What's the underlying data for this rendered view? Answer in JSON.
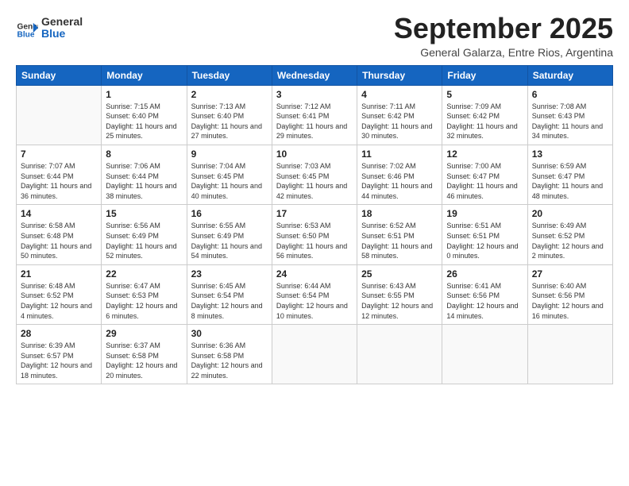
{
  "header": {
    "logo_general": "General",
    "logo_blue": "Blue",
    "month_title": "September 2025",
    "location": "General Galarza, Entre Rios, Argentina"
  },
  "weekdays": [
    "Sunday",
    "Monday",
    "Tuesday",
    "Wednesday",
    "Thursday",
    "Friday",
    "Saturday"
  ],
  "days": [
    {
      "date": "",
      "number": "",
      "sunrise": "",
      "sunset": "",
      "daylight": ""
    },
    {
      "date": "1",
      "number": "1",
      "sunrise": "Sunrise: 7:15 AM",
      "sunset": "Sunset: 6:40 PM",
      "daylight": "Daylight: 11 hours and 25 minutes."
    },
    {
      "date": "2",
      "number": "2",
      "sunrise": "Sunrise: 7:13 AM",
      "sunset": "Sunset: 6:40 PM",
      "daylight": "Daylight: 11 hours and 27 minutes."
    },
    {
      "date": "3",
      "number": "3",
      "sunrise": "Sunrise: 7:12 AM",
      "sunset": "Sunset: 6:41 PM",
      "daylight": "Daylight: 11 hours and 29 minutes."
    },
    {
      "date": "4",
      "number": "4",
      "sunrise": "Sunrise: 7:11 AM",
      "sunset": "Sunset: 6:42 PM",
      "daylight": "Daylight: 11 hours and 30 minutes."
    },
    {
      "date": "5",
      "number": "5",
      "sunrise": "Sunrise: 7:09 AM",
      "sunset": "Sunset: 6:42 PM",
      "daylight": "Daylight: 11 hours and 32 minutes."
    },
    {
      "date": "6",
      "number": "6",
      "sunrise": "Sunrise: 7:08 AM",
      "sunset": "Sunset: 6:43 PM",
      "daylight": "Daylight: 11 hours and 34 minutes."
    },
    {
      "date": "7",
      "number": "7",
      "sunrise": "Sunrise: 7:07 AM",
      "sunset": "Sunset: 6:44 PM",
      "daylight": "Daylight: 11 hours and 36 minutes."
    },
    {
      "date": "8",
      "number": "8",
      "sunrise": "Sunrise: 7:06 AM",
      "sunset": "Sunset: 6:44 PM",
      "daylight": "Daylight: 11 hours and 38 minutes."
    },
    {
      "date": "9",
      "number": "9",
      "sunrise": "Sunrise: 7:04 AM",
      "sunset": "Sunset: 6:45 PM",
      "daylight": "Daylight: 11 hours and 40 minutes."
    },
    {
      "date": "10",
      "number": "10",
      "sunrise": "Sunrise: 7:03 AM",
      "sunset": "Sunset: 6:45 PM",
      "daylight": "Daylight: 11 hours and 42 minutes."
    },
    {
      "date": "11",
      "number": "11",
      "sunrise": "Sunrise: 7:02 AM",
      "sunset": "Sunset: 6:46 PM",
      "daylight": "Daylight: 11 hours and 44 minutes."
    },
    {
      "date": "12",
      "number": "12",
      "sunrise": "Sunrise: 7:00 AM",
      "sunset": "Sunset: 6:47 PM",
      "daylight": "Daylight: 11 hours and 46 minutes."
    },
    {
      "date": "13",
      "number": "13",
      "sunrise": "Sunrise: 6:59 AM",
      "sunset": "Sunset: 6:47 PM",
      "daylight": "Daylight: 11 hours and 48 minutes."
    },
    {
      "date": "14",
      "number": "14",
      "sunrise": "Sunrise: 6:58 AM",
      "sunset": "Sunset: 6:48 PM",
      "daylight": "Daylight: 11 hours and 50 minutes."
    },
    {
      "date": "15",
      "number": "15",
      "sunrise": "Sunrise: 6:56 AM",
      "sunset": "Sunset: 6:49 PM",
      "daylight": "Daylight: 11 hours and 52 minutes."
    },
    {
      "date": "16",
      "number": "16",
      "sunrise": "Sunrise: 6:55 AM",
      "sunset": "Sunset: 6:49 PM",
      "daylight": "Daylight: 11 hours and 54 minutes."
    },
    {
      "date": "17",
      "number": "17",
      "sunrise": "Sunrise: 6:53 AM",
      "sunset": "Sunset: 6:50 PM",
      "daylight": "Daylight: 11 hours and 56 minutes."
    },
    {
      "date": "18",
      "number": "18",
      "sunrise": "Sunrise: 6:52 AM",
      "sunset": "Sunset: 6:51 PM",
      "daylight": "Daylight: 11 hours and 58 minutes."
    },
    {
      "date": "19",
      "number": "19",
      "sunrise": "Sunrise: 6:51 AM",
      "sunset": "Sunset: 6:51 PM",
      "daylight": "Daylight: 12 hours and 0 minutes."
    },
    {
      "date": "20",
      "number": "20",
      "sunrise": "Sunrise: 6:49 AM",
      "sunset": "Sunset: 6:52 PM",
      "daylight": "Daylight: 12 hours and 2 minutes."
    },
    {
      "date": "21",
      "number": "21",
      "sunrise": "Sunrise: 6:48 AM",
      "sunset": "Sunset: 6:52 PM",
      "daylight": "Daylight: 12 hours and 4 minutes."
    },
    {
      "date": "22",
      "number": "22",
      "sunrise": "Sunrise: 6:47 AM",
      "sunset": "Sunset: 6:53 PM",
      "daylight": "Daylight: 12 hours and 6 minutes."
    },
    {
      "date": "23",
      "number": "23",
      "sunrise": "Sunrise: 6:45 AM",
      "sunset": "Sunset: 6:54 PM",
      "daylight": "Daylight: 12 hours and 8 minutes."
    },
    {
      "date": "24",
      "number": "24",
      "sunrise": "Sunrise: 6:44 AM",
      "sunset": "Sunset: 6:54 PM",
      "daylight": "Daylight: 12 hours and 10 minutes."
    },
    {
      "date": "25",
      "number": "25",
      "sunrise": "Sunrise: 6:43 AM",
      "sunset": "Sunset: 6:55 PM",
      "daylight": "Daylight: 12 hours and 12 minutes."
    },
    {
      "date": "26",
      "number": "26",
      "sunrise": "Sunrise: 6:41 AM",
      "sunset": "Sunset: 6:56 PM",
      "daylight": "Daylight: 12 hours and 14 minutes."
    },
    {
      "date": "27",
      "number": "27",
      "sunrise": "Sunrise: 6:40 AM",
      "sunset": "Sunset: 6:56 PM",
      "daylight": "Daylight: 12 hours and 16 minutes."
    },
    {
      "date": "28",
      "number": "28",
      "sunrise": "Sunrise: 6:39 AM",
      "sunset": "Sunset: 6:57 PM",
      "daylight": "Daylight: 12 hours and 18 minutes."
    },
    {
      "date": "29",
      "number": "29",
      "sunrise": "Sunrise: 6:37 AM",
      "sunset": "Sunset: 6:58 PM",
      "daylight": "Daylight: 12 hours and 20 minutes."
    },
    {
      "date": "30",
      "number": "30",
      "sunrise": "Sunrise: 6:36 AM",
      "sunset": "Sunset: 6:58 PM",
      "daylight": "Daylight: 12 hours and 22 minutes."
    }
  ]
}
